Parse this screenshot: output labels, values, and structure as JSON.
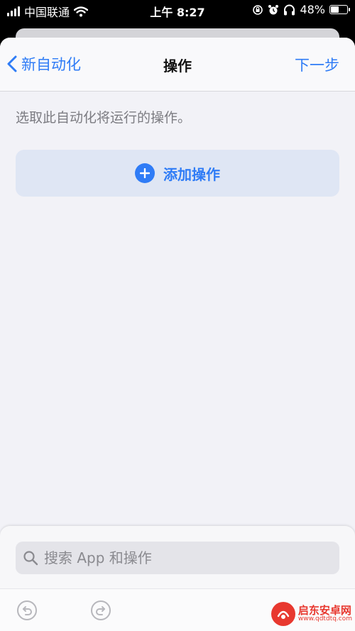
{
  "status_bar": {
    "carrier": "中国联通",
    "time": "上午 8:27",
    "battery_percent": "48%",
    "battery_level": 0.48,
    "icons": [
      "signal-icon",
      "wifi-icon",
      "orientation-lock-icon",
      "alarm-icon",
      "headphones-icon",
      "battery-icon"
    ]
  },
  "nav": {
    "back_label": "新自动化",
    "title": "操作",
    "next_label": "下一步"
  },
  "content": {
    "hint": "选取此自动化将运行的操作。",
    "add_action_label": "添加操作"
  },
  "search": {
    "placeholder": "搜索 App 和操作"
  },
  "toolbar": {
    "icons": [
      "undo-icon",
      "redo-icon"
    ]
  },
  "watermark": {
    "title": "启东安卓网",
    "url": "www.qdtdtq.com"
  },
  "colors": {
    "accent": "#2f7cf6",
    "background": "#f2f2f7",
    "add_button_bg": "#dfe6f4",
    "watermark": "#e8382f"
  }
}
